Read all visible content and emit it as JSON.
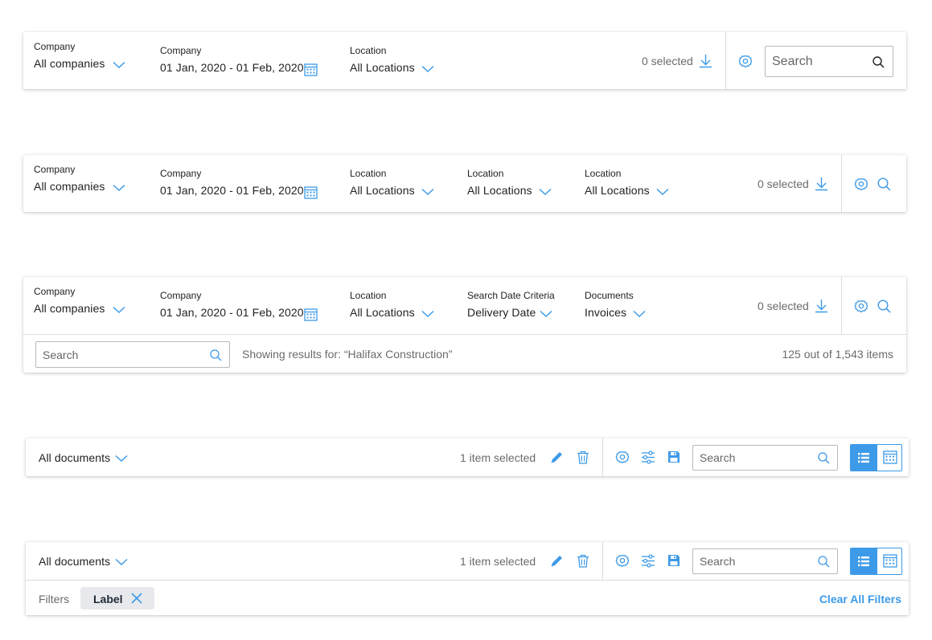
{
  "colors": {
    "accent": "#3d9ae8",
    "divider": "#dcdcdc",
    "text": "#222222",
    "muted": "#6b6b6b"
  },
  "bar1": {
    "filters": [
      {
        "label": "Company",
        "value": "All companies",
        "icon": "chevron-down-icon"
      },
      {
        "label": "Company",
        "value": "01 Jan, 2020 - 01 Feb, 2020",
        "icon": "calendar-icon"
      },
      {
        "label": "Location",
        "value": "All Locations",
        "icon": "chevron-down-icon"
      }
    ],
    "selected": "0 selected",
    "search_placeholder": "Search"
  },
  "bar2": {
    "filters": [
      {
        "label": "Company",
        "value": "All companies",
        "icon": "chevron-down-icon"
      },
      {
        "label": "Company",
        "value": "01 Jan, 2020 - 01 Feb, 2020",
        "icon": "calendar-icon"
      },
      {
        "label": "Location",
        "value": "All Locations",
        "icon": "chevron-down-icon"
      },
      {
        "label": "Location",
        "value": "All Locations",
        "icon": "chevron-down-icon"
      },
      {
        "label": "Location",
        "value": "All Locations",
        "icon": "chevron-down-icon"
      }
    ],
    "selected": "0 selected"
  },
  "bar3": {
    "filters": [
      {
        "label": "Company",
        "value": "All companies",
        "icon": "chevron-down-icon"
      },
      {
        "label": "Company",
        "value": "01 Jan, 2020 - 01 Feb, 2020",
        "icon": "calendar-icon"
      },
      {
        "label": "Location",
        "value": "All Locations",
        "icon": "chevron-down-icon"
      },
      {
        "label": "Search Date Criteria",
        "value": "Delivery Date",
        "icon": "chevron-down-icon"
      },
      {
        "label": "Documents",
        "value": "Invoices",
        "icon": "chevron-down-icon"
      }
    ],
    "selected": "0 selected",
    "search_placeholder": "Search",
    "results_text": "Showing results for: “Halifax Construction”",
    "count_text": "125 out of 1,543 items"
  },
  "bar4": {
    "dropdown": "All documents",
    "selected": "1 item selected",
    "search_placeholder": "Search",
    "view_mode": "list"
  },
  "bar5": {
    "dropdown": "All documents",
    "selected": "1 item selected",
    "search_placeholder": "Search",
    "view_mode": "list",
    "filters_label": "Filters",
    "chip_label": "Label",
    "clear_all": "Clear All Filters"
  }
}
